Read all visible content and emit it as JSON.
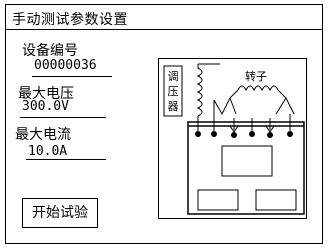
{
  "window": {
    "title": "手动测试参数设置"
  },
  "fields": [
    {
      "label": "设备编号",
      "value": "00000036"
    },
    {
      "label": "最大电压",
      "value": "300.0V"
    },
    {
      "label": "最大电流",
      "value": "10.0A"
    }
  ],
  "buttons": {
    "start": "开始试验"
  },
  "diagram": {
    "regulator_label": [
      "调",
      "压",
      "器"
    ],
    "rotor_label": "转子"
  }
}
